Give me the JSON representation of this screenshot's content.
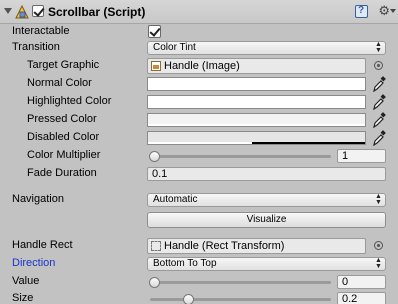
{
  "component": {
    "title": "Scrollbar (Script)",
    "icons": {
      "fold": "foldout-arrow-icon",
      "script": "script-icon",
      "help": "help-book-icon",
      "settings": "gear-icon"
    }
  },
  "properties": {
    "interactable": {
      "label": "Interactable",
      "checked": true
    },
    "transition": {
      "label": "Transition",
      "value": "Color Tint"
    },
    "target_graphic": {
      "label": "Target Graphic",
      "value": "Handle (Image)"
    },
    "normal_color": {
      "label": "Normal Color",
      "color": "#ffffff"
    },
    "highlighted_color": {
      "label": "Highlighted Color",
      "color": "#ffffff"
    },
    "pressed_color": {
      "label": "Pressed Color",
      "color": "#f3f3f3"
    },
    "disabled_color": {
      "label": "Disabled Color",
      "color": "#e6e6e6"
    },
    "color_multiplier": {
      "label": "Color Multiplier",
      "value": "1",
      "fraction": 0.0
    },
    "fade_duration": {
      "label": "Fade Duration",
      "value": "0.1"
    },
    "navigation": {
      "label": "Navigation",
      "value": "Automatic"
    },
    "visualize": {
      "label": "Visualize"
    },
    "handle_rect": {
      "label": "Handle Rect",
      "value": "Handle (Rect Transform)"
    },
    "direction": {
      "label": "Direction",
      "value": "Bottom To Top"
    },
    "value": {
      "label": "Value",
      "value": "0",
      "fraction": 0.0
    },
    "size": {
      "label": "Size",
      "value": "0.2",
      "fraction": 0.2
    }
  },
  "colors": {
    "background": "#c2c2c2",
    "label_highlight": "#1a34c8"
  }
}
